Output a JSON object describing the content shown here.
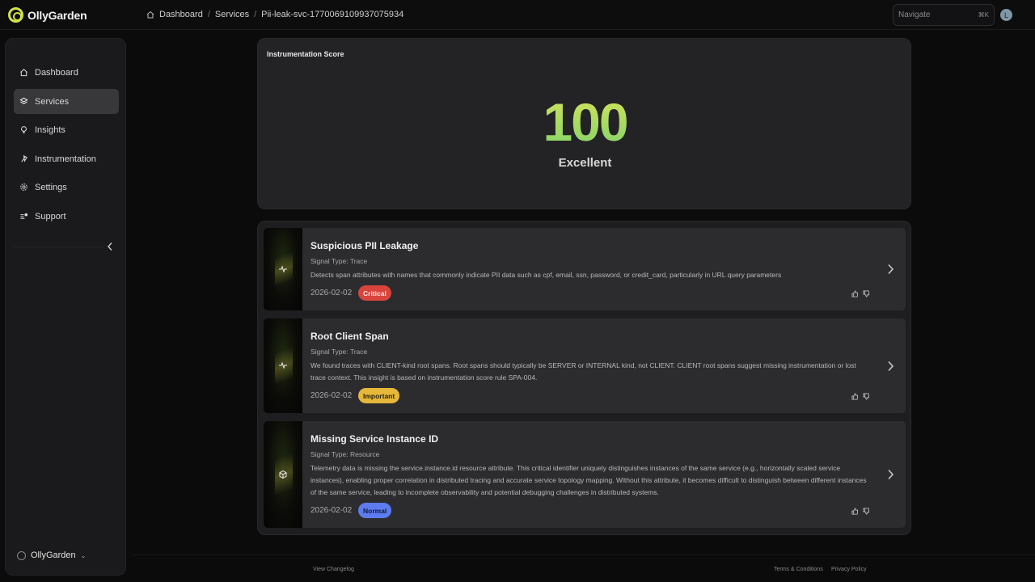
{
  "brand": {
    "name": "OllyGarden"
  },
  "breadcrumb": {
    "items": [
      "Dashboard",
      "Services",
      "Pii-leak-svc-1770069109937075934"
    ]
  },
  "nav_search": {
    "placeholder": "Navigate",
    "shortcut": "⌘K"
  },
  "user": {
    "initial": "L"
  },
  "sidebar": {
    "items": [
      {
        "label": "Dashboard",
        "icon": "home-icon"
      },
      {
        "label": "Services",
        "icon": "layers-icon",
        "active": true
      },
      {
        "label": "Insights",
        "icon": "lightbulb-icon"
      },
      {
        "label": "Instrumentation",
        "icon": "instrumentation-icon"
      },
      {
        "label": "Settings",
        "icon": "gear-icon"
      },
      {
        "label": "Support",
        "icon": "support-icon"
      }
    ],
    "org": "OllyGarden"
  },
  "score": {
    "title": "Instrumentation Score",
    "value": "100",
    "label": "Excellent"
  },
  "insights": [
    {
      "title": "Suspicious PII Leakage",
      "signal": "Signal Type: Trace",
      "description": "Detects span attributes with names that commonly indicate PII data such as cpf, email, ssn, password, or credit_card, particularly in URL query parameters",
      "date": "2026-02-02",
      "severity": "Critical",
      "icon": "trace-icon"
    },
    {
      "title": "Root Client Span",
      "signal": "Signal Type: Trace",
      "description": "We found traces with CLIENT-kind root spans. Root spans should typically be SERVER or INTERNAL kind, not CLIENT. CLIENT root spans suggest missing instrumentation or lost trace context. This insight is based on instrumentation score rule SPA-004.",
      "date": "2026-02-02",
      "severity": "Important",
      "icon": "trace-icon"
    },
    {
      "title": "Missing Service Instance ID",
      "signal": "Signal Type: Resource",
      "description": "Telemetry data is missing the service.instance.id resource attribute. This critical identifier uniquely distinguishes instances of the same service (e.g., horizontally scaled service instances), enabling proper correlation in distributed tracing and accurate service topology mapping. Without this attribute, it becomes difficult to distinguish between different instances of the same service, leading to incomplete observability and potential debugging challenges in distributed systems.",
      "date": "2026-02-02",
      "severity": "Normal",
      "icon": "resource-icon"
    }
  ],
  "footer": {
    "changelog": "View Changelog",
    "terms": "Terms & Conditions",
    "privacy": "Privacy Policy"
  },
  "colors": {
    "accent": "#d4e14a",
    "critical": "#d9443c",
    "important": "#e5b83a",
    "normal": "#5d7cf0"
  }
}
